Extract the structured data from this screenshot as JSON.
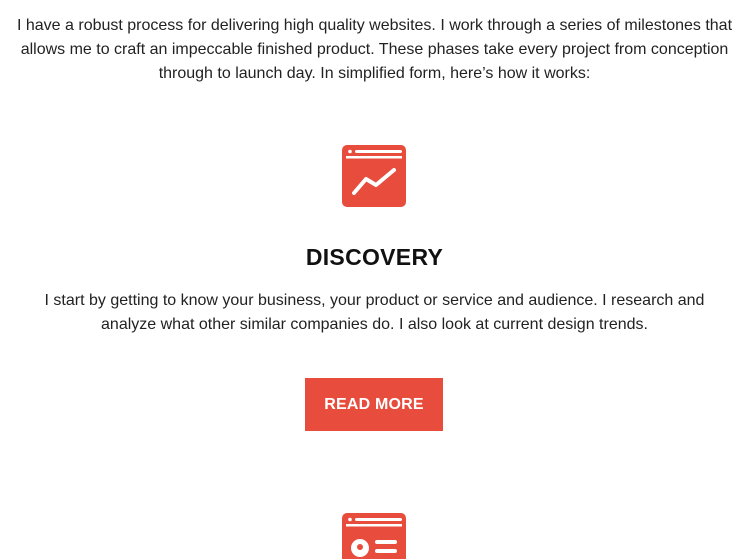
{
  "intro": {
    "text": "I have a robust process for delivering high quality websites. I work through a series of milestones that allows me to craft an impeccable finished product. These phases take every project from conception through to launch day. In simplified form, here’s how it works:"
  },
  "steps": [
    {
      "icon": "browser-chart-icon",
      "title": "DISCOVERY",
      "description": "I start by getting to know your business, your product or service and audience. I research and analyze what other similar companies do. I also look at current design trends.",
      "button_label": "READ MORE"
    },
    {
      "icon": "browser-profile-icon"
    }
  ],
  "colors": {
    "accent": "#e74c3c",
    "text": "#222222",
    "background": "#ffffff"
  }
}
